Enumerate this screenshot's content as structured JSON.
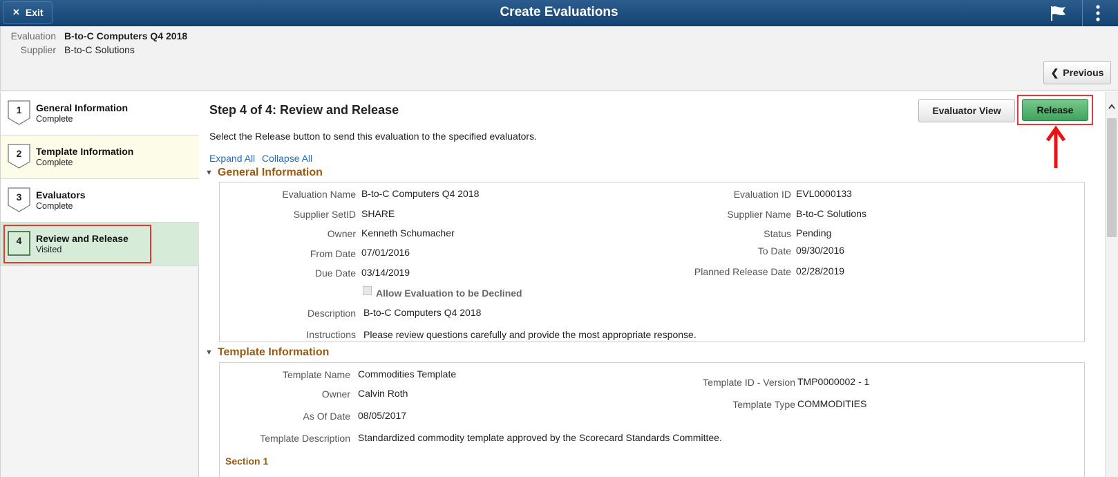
{
  "header": {
    "exit_label": "Exit",
    "title": "Create Evaluations",
    "icons": {
      "exit": "close-icon",
      "flag": "flag-icon",
      "menu": "more-vertical-icon"
    }
  },
  "info": {
    "evaluation_label": "Evaluation",
    "evaluation_value": "B-to-C Computers  Q4 2018",
    "supplier_label": "Supplier",
    "supplier_value": "B-to-C Solutions",
    "previous_label": "Previous"
  },
  "nav": {
    "items": [
      {
        "num": "1",
        "title": "General Information",
        "status": "Complete"
      },
      {
        "num": "2",
        "title": "Template Information",
        "status": "Complete"
      },
      {
        "num": "3",
        "title": "Evaluators",
        "status": "Complete"
      },
      {
        "num": "4",
        "title": "Review and Release",
        "status": "Visited"
      }
    ]
  },
  "main": {
    "step_title": "Step 4 of 4: Review and Release",
    "step_desc": "Select the Release button to send this evaluation to the specified evaluators.",
    "expand_all": "Expand All",
    "collapse_all": "Collapse All",
    "evaluator_view_label": "Evaluator View",
    "release_label": "Release",
    "general": {
      "header": "General Information",
      "eval_name_label": "Evaluation Name",
      "eval_name_value": "B-to-C Computers  Q4 2018",
      "eval_id_label": "Evaluation ID",
      "eval_id_value": "EVL0000133",
      "setid_label": "Supplier SetID",
      "setid_value": "SHARE",
      "supplier_name_label": "Supplier Name",
      "supplier_name_value": "B-to-C Solutions",
      "owner_label": "Owner",
      "owner_value": "Kenneth Schumacher",
      "status_label": "Status",
      "status_value": "Pending",
      "from_label": "From Date",
      "from_value": "07/01/2016",
      "to_label": "To Date",
      "to_value": "09/30/2016",
      "due_label": "Due Date",
      "due_value": "03/14/2019",
      "planned_label": "Planned Release Date",
      "planned_value": "02/28/2019",
      "allow_decline_label": "Allow Evaluation to be Declined",
      "allow_decline_checked": false,
      "desc_label": "Description",
      "desc_value": "B-to-C Computers  Q4 2018",
      "instr_label": "Instructions",
      "instr_value": "Please review questions carefully and provide the most appropriate response."
    },
    "template": {
      "header": "Template Information",
      "name_label": "Template Name",
      "name_value": "Commodities Template",
      "id_label": "Template ID - Version",
      "id_value": "TMP0000002 - 1",
      "owner_label": "Owner",
      "owner_value": "Calvin Roth",
      "type_label": "Template Type",
      "type_value": "COMMODITIES",
      "asof_label": "As Of Date",
      "asof_value": "08/05/2017",
      "desc_label": "Template Description",
      "desc_value": "Standardized commodity template approved by the Scorecard Standards Committee.",
      "section_label": "Section 1"
    }
  },
  "colors": {
    "banner": "#1d4f82",
    "section_header": "#9c5b12",
    "link": "#1f6bc1",
    "release_green": "#4fb06b",
    "highlight_red": "#e33333",
    "current_step_bg": "#d6ebd8"
  }
}
